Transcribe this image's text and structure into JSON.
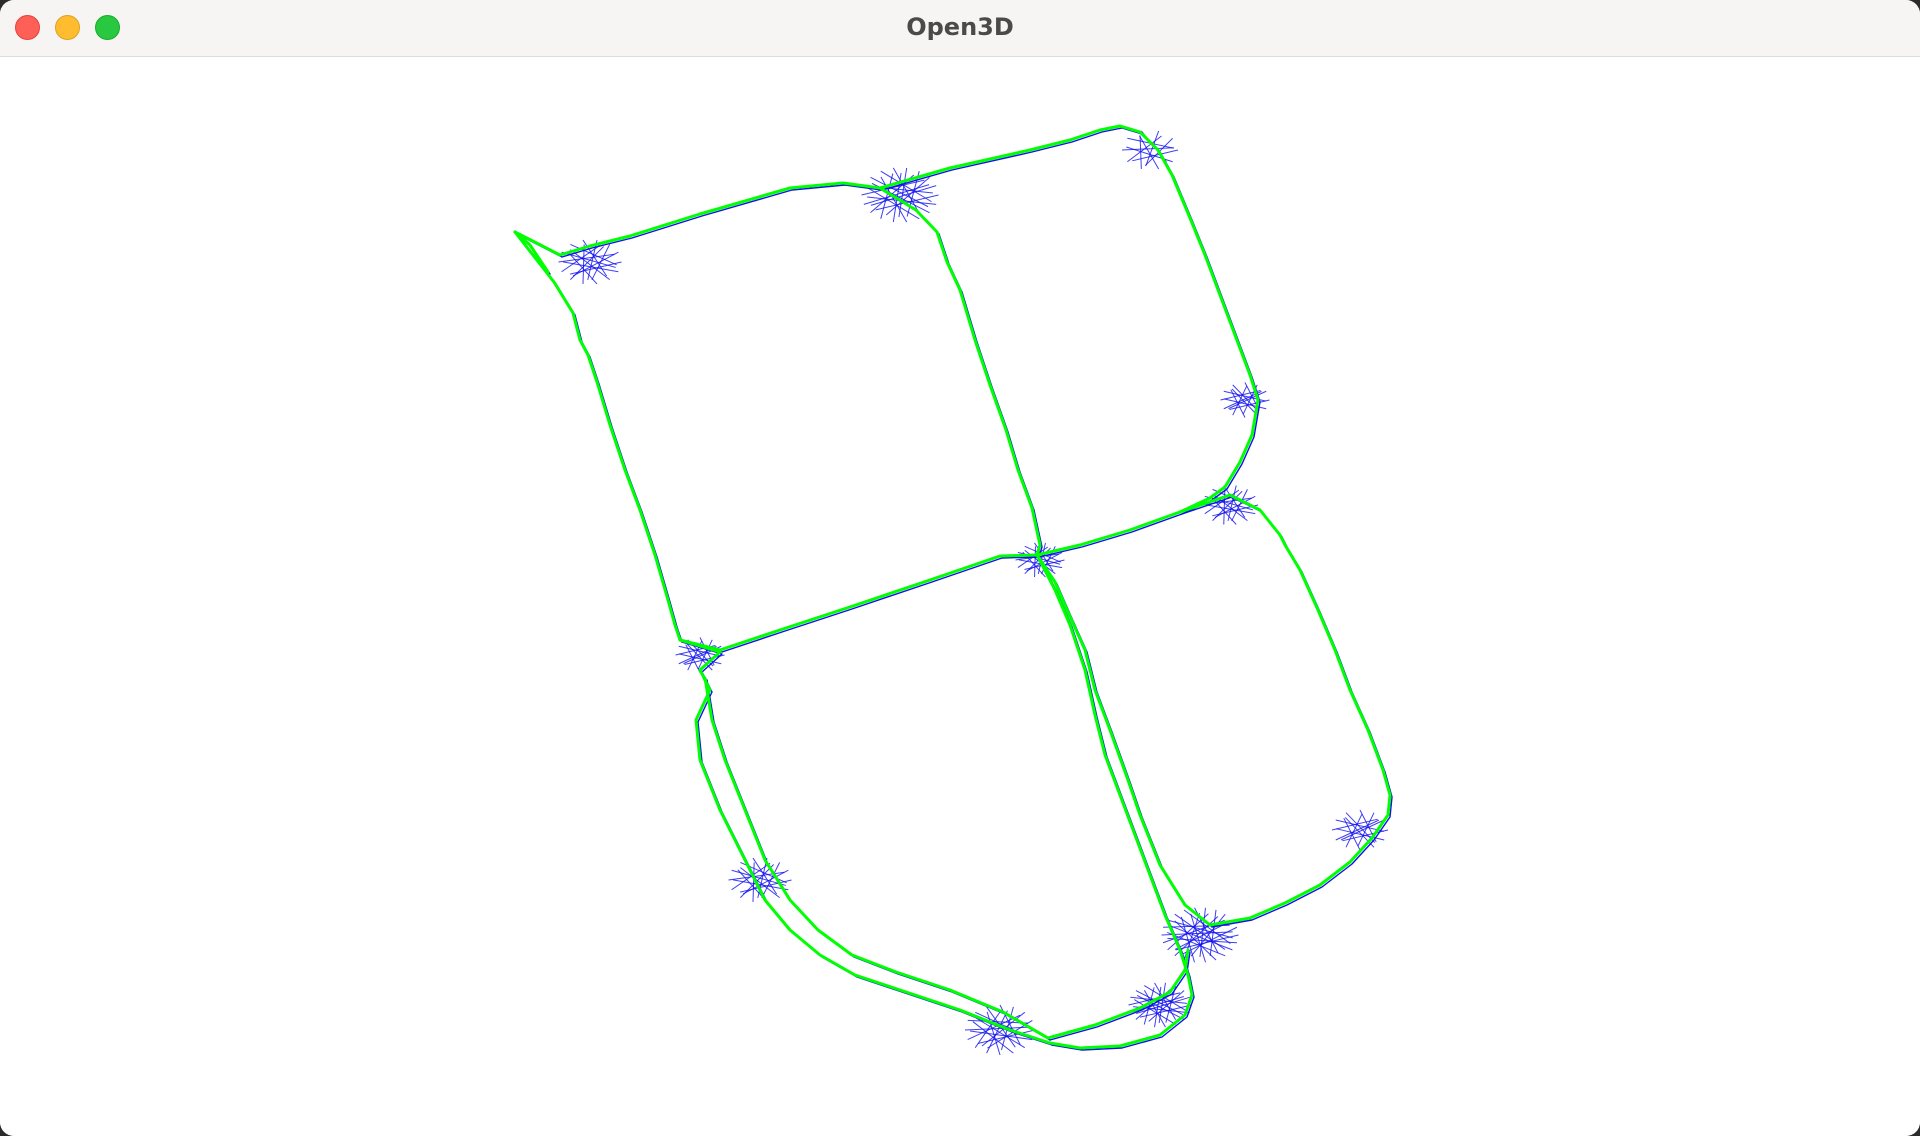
{
  "window": {
    "title": "Open3D",
    "buttons": [
      "close",
      "minimize",
      "maximize"
    ]
  },
  "visualization": {
    "description_icon": "pose-graph-trajectory",
    "edge_color": "#1010ee",
    "node_color": "#00ff00",
    "background_color": "#ffffff"
  }
}
